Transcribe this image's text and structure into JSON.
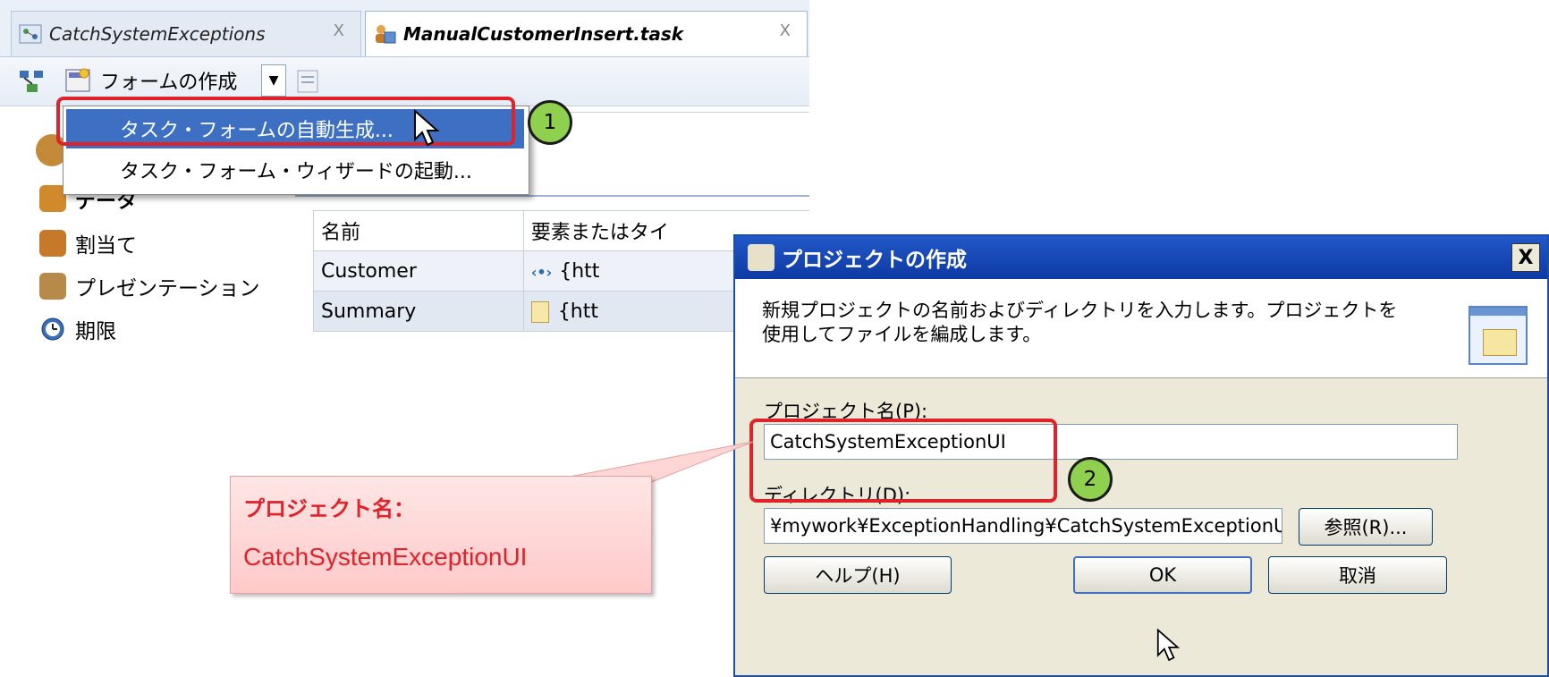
{
  "editor": {
    "tabs": [
      {
        "label": "CatchSystemExceptions",
        "close": "X"
      },
      {
        "label": "ManualCustomerInsert.task",
        "close": "X"
      }
    ],
    "toolbar": {
      "form_create_label": "フォームの作成"
    },
    "dropdown": {
      "items": [
        "タスク・フォームの自動生成...",
        "タスク・フォーム・ウィザードの起動..."
      ]
    },
    "sidenav": {
      "items": [
        "データ",
        "割当て",
        "プレゼンテーション",
        "期限"
      ]
    },
    "table": {
      "columns": [
        "名前",
        "要素またはタイ"
      ],
      "rows": [
        {
          "name": "Customer",
          "type": "{htt"
        },
        {
          "name": "Summary",
          "type": "{htt"
        }
      ]
    }
  },
  "steps": [
    "1",
    "2"
  ],
  "dialog": {
    "title": "プロジェクトの作成",
    "close": "X",
    "description_line1": "新規プロジェクトの名前およびディレクトリを入力します。プロジェクトを",
    "description_line2": "使用してファイルを編成します。",
    "project_name_label": "プロジェクト名(P):",
    "project_name_value": "CatchSystemExceptionUI",
    "directory_label": "ディレクトリ(D):",
    "directory_value": "¥mywork¥ExceptionHandling¥CatchSystemExceptionUI",
    "browse_label": "参照(R)...",
    "help_label": "ヘルプ(H)",
    "ok_label": "OK",
    "cancel_label": "取消"
  },
  "callout": {
    "title": "プロジェクト名：",
    "value": "CatchSystemExceptionUI"
  },
  "colors": {
    "highlight": "#e0222a",
    "step_circle": "#8fd14f",
    "menu_selected": "#3d6fc3",
    "title_bar": "#1a4cb8"
  }
}
